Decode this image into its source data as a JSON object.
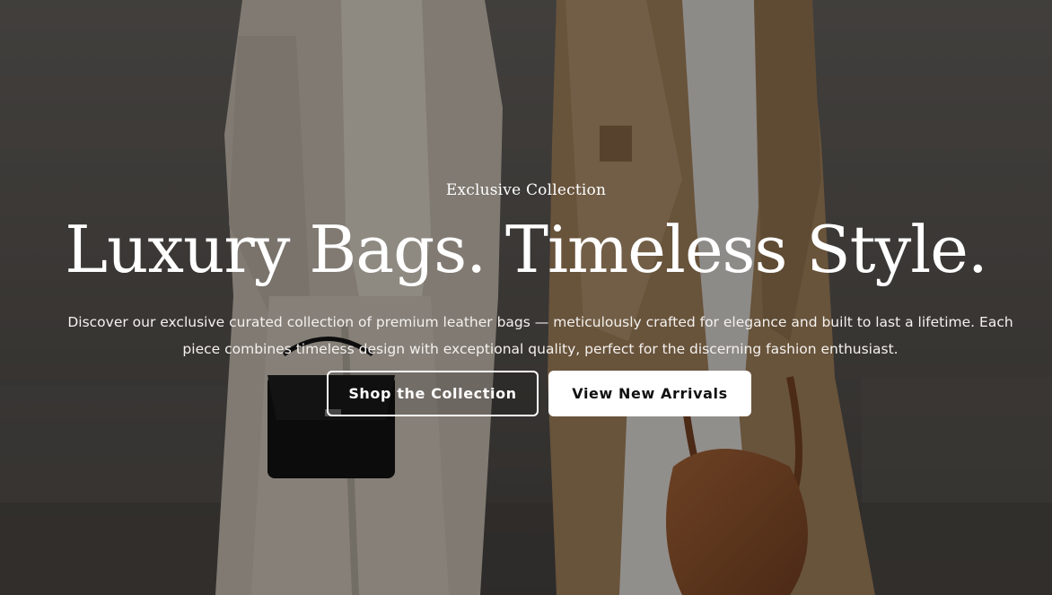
{
  "hero": {
    "eyebrow": "Exclusive Collection",
    "headline": "Luxury Bags. Timeless Style.",
    "description": "Discover our exclusive curated collection of premium leather bags — meticulously crafted for elegance and built to last a lifetime. Each piece combines timeless design with exceptional quality, perfect for the discerning fashion enthusiast.",
    "primary_cta": "Shop the Collection",
    "secondary_cta": "View New Arrivals"
  },
  "colors": {
    "text": "#ffffff",
    "overlay": "#000000",
    "coat_tan": "#a9865f",
    "suit_cream": "#ddd3c6",
    "bag_black": "#141414",
    "bag_brown": "#9a5a32"
  }
}
